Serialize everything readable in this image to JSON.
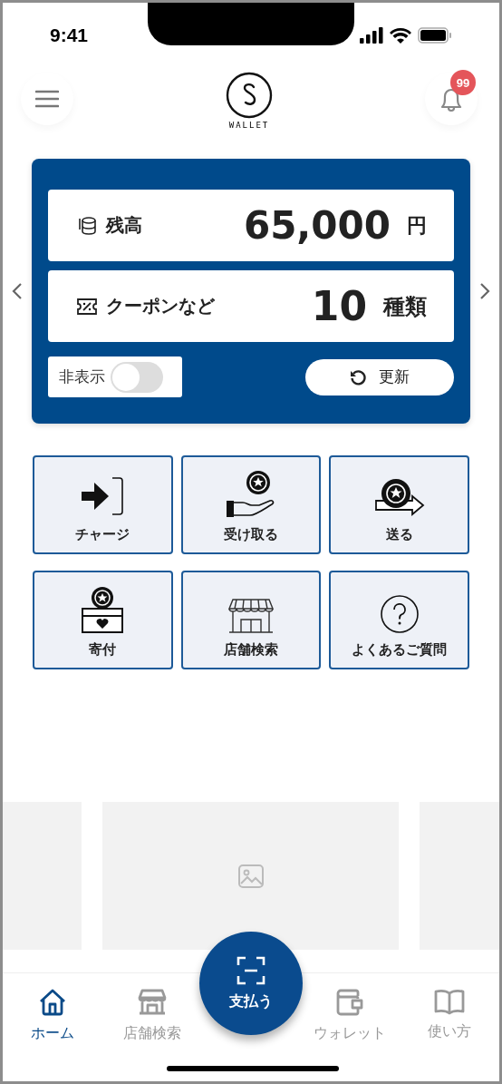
{
  "status_bar": {
    "time": "9:41"
  },
  "header": {
    "logo_text": "WALLET",
    "notification_count": "99"
  },
  "balance_card": {
    "rows": [
      {
        "kind": "balance",
        "label": "残高",
        "value": "65,000",
        "unit": "円"
      },
      {
        "kind": "coupon",
        "label": "クーポンなど",
        "value": "10",
        "unit": "種類"
      }
    ],
    "hide_toggle": {
      "label": "非表示",
      "on": false
    },
    "refresh_button": "更新"
  },
  "actions": [
    {
      "kind": "charge",
      "label": "チャージ"
    },
    {
      "kind": "receive",
      "label": "受け取る"
    },
    {
      "kind": "send",
      "label": "送る"
    },
    {
      "kind": "donate",
      "label": "寄付"
    },
    {
      "kind": "store",
      "label": "店舗検索"
    },
    {
      "kind": "faq",
      "label": "よくあるご質問"
    }
  ],
  "tab_bar": [
    {
      "kind": "home",
      "label": "ホーム",
      "selected": true
    },
    {
      "kind": "store",
      "label": "店舗検索",
      "selected": false
    },
    {
      "kind": "pay",
      "label": "支払う",
      "selected": false
    },
    {
      "kind": "wallet",
      "label": "ウォレット",
      "selected": false
    },
    {
      "kind": "guide",
      "label": "使い方",
      "selected": false
    }
  ]
}
